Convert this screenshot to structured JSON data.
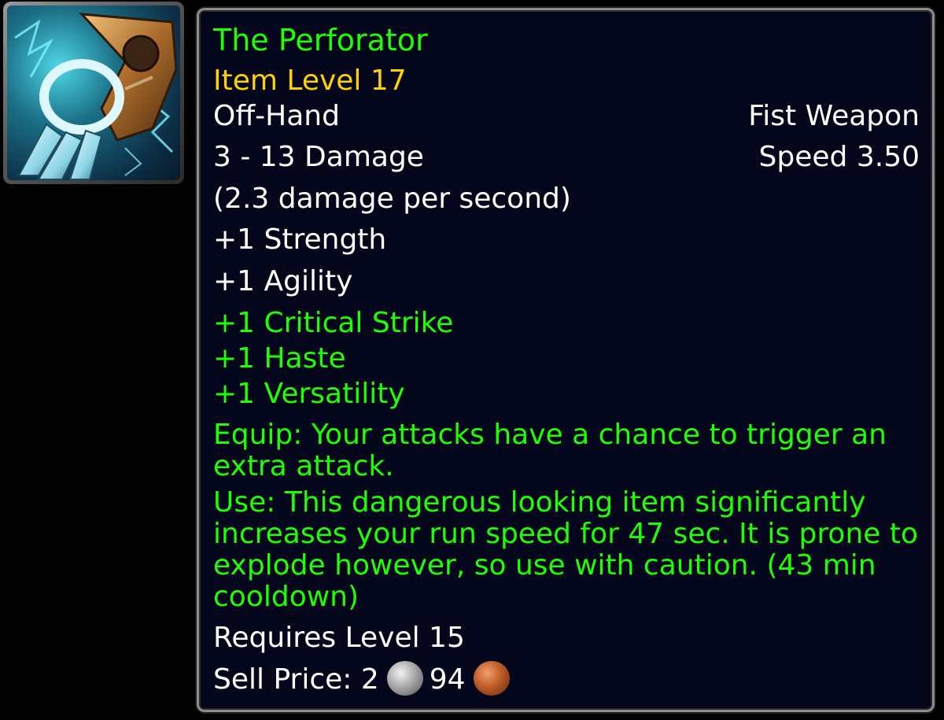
{
  "item": {
    "name": "The Perforator",
    "item_level": "Item Level 17",
    "slot": "Off-Hand",
    "type": "Fist Weapon",
    "damage": "3 - 13 Damage",
    "speed": "Speed 3.50",
    "dps": "(2.3 damage per second)",
    "stats": [
      "+1 Strength",
      "+1 Agility"
    ],
    "secondary_stats": [
      "+1 Critical Strike",
      "+1 Haste",
      "+1 Versatility"
    ],
    "equip_effect": "Equip: Your attacks have a chance to trigger an extra attack.",
    "use_effect": "Use: This dangerous looking item significantly increases your run speed for 47 sec. It is prone to explode however, so use with caution. (43 min cooldown)",
    "requirement": "Requires Level 15",
    "sell_price_label": "Sell Price:",
    "sell_silver": "2",
    "sell_copper": "94",
    "icon": "fist-weapon-icon"
  },
  "colors": {
    "name_uncommon": "#1eff00",
    "item_level": "#ffd100",
    "text": "#ffffff",
    "effect": "#1eff00",
    "background": "#04071b",
    "border": "#8d8d8d"
  }
}
